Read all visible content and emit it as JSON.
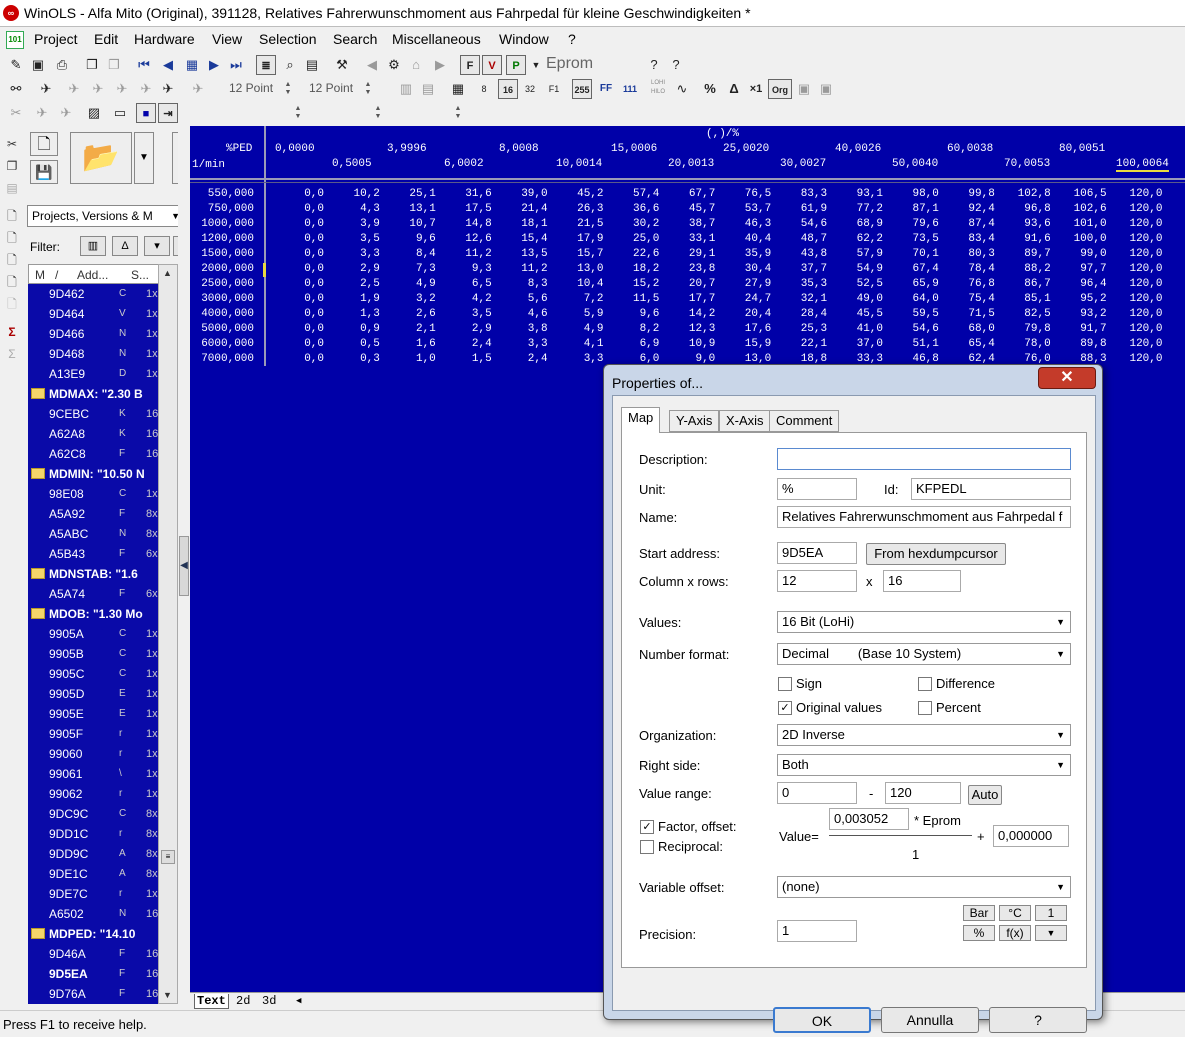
{
  "window": {
    "title": "WinOLS - Alfa Mito (Original), 391128, Relatives Fahrerwunschmoment aus Fahrpedal für kleine Geschwindigkeiten *",
    "app_icon": "winols-logo-icon"
  },
  "menu": [
    "Project",
    "Edit",
    "Hardware",
    "View",
    "Selection",
    "Search",
    "Miscellaneous",
    "Window",
    "?"
  ],
  "toolbar": {
    "eprom_label": "Eprom",
    "point_size_1": "12 Point",
    "point_size_2": "12 Point",
    "btn_255": "255",
    "btn_ff": "FF",
    "btn_111": "111",
    "btn_lohi": "LOHI HILO",
    "btn_x1": "×1",
    "btn_org": "Org"
  },
  "sidebar": {
    "combo": "Projects, Versions & M",
    "filter_label": "Filter:",
    "list_headers": [
      "M",
      "/",
      "Add...",
      "S..."
    ],
    "items": [
      {
        "type": "item",
        "addr": "9D462",
        "c2": "C",
        "c3": "1x"
      },
      {
        "type": "item",
        "addr": "9D464",
        "c2": "V",
        "c3": "1x"
      },
      {
        "type": "item",
        "addr": "9D466",
        "c2": "N",
        "c3": "1x"
      },
      {
        "type": "item",
        "addr": "9D468",
        "c2": "N",
        "c3": "1x"
      },
      {
        "type": "item",
        "addr": "A13E9",
        "c2": "D",
        "c3": "1x"
      },
      {
        "type": "group",
        "name": "MDMAX: \"2.30 B"
      },
      {
        "type": "item",
        "addr": "9CEBC",
        "c2": "K",
        "c3": "16"
      },
      {
        "type": "item",
        "addr": "A62A8",
        "c2": "K",
        "c3": "16"
      },
      {
        "type": "item",
        "addr": "A62C8",
        "c2": "F",
        "c3": "16"
      },
      {
        "type": "group",
        "name": "MDMIN: \"10.50 N"
      },
      {
        "type": "item",
        "addr": "98E08",
        "c2": "C",
        "c3": "1x"
      },
      {
        "type": "item",
        "addr": "A5A92",
        "c2": "F",
        "c3": "8x"
      },
      {
        "type": "item",
        "addr": "A5ABC",
        "c2": "N",
        "c3": "8x"
      },
      {
        "type": "item",
        "addr": "A5B43",
        "c2": "F",
        "c3": "6x"
      },
      {
        "type": "group",
        "name": "MDNSTAB: \"1.6"
      },
      {
        "type": "item",
        "addr": "A5A74",
        "c2": "F",
        "c3": "6x"
      },
      {
        "type": "group",
        "name": "MDOB: \"1.30 Mo"
      },
      {
        "type": "item",
        "addr": "9905A",
        "c2": "C",
        "c3": "1x"
      },
      {
        "type": "item",
        "addr": "9905B",
        "c2": "C",
        "c3": "1x"
      },
      {
        "type": "item",
        "addr": "9905C",
        "c2": "C",
        "c3": "1x"
      },
      {
        "type": "item",
        "addr": "9905D",
        "c2": "E",
        "c3": "1x"
      },
      {
        "type": "item",
        "addr": "9905E",
        "c2": "E",
        "c3": "1x"
      },
      {
        "type": "item",
        "addr": "9905F",
        "c2": "r",
        "c3": "1x"
      },
      {
        "type": "item",
        "addr": "99060",
        "c2": "r",
        "c3": "1x"
      },
      {
        "type": "item",
        "addr": "99061",
        "c2": "\\",
        "c3": "1x"
      },
      {
        "type": "item",
        "addr": "99062",
        "c2": "r",
        "c3": "1x"
      },
      {
        "type": "item",
        "addr": "9DC9C",
        "c2": "C",
        "c3": "8x"
      },
      {
        "type": "item",
        "addr": "9DD1C",
        "c2": "r",
        "c3": "8x"
      },
      {
        "type": "item",
        "addr": "9DD9C",
        "c2": "A",
        "c3": "8x"
      },
      {
        "type": "item",
        "addr": "9DE1C",
        "c2": "A",
        "c3": "8x"
      },
      {
        "type": "item",
        "addr": "9DE7C",
        "c2": "r",
        "c3": "1x"
      },
      {
        "type": "item",
        "addr": "A6502",
        "c2": "N",
        "c3": "16"
      },
      {
        "type": "group",
        "name": "MDPED: \"14.10"
      },
      {
        "type": "item",
        "addr": "9D46A",
        "c2": "F",
        "c3": "16"
      },
      {
        "type": "item",
        "addr": "9D5EA",
        "c2": "F",
        "c3": "16",
        "bold": true
      },
      {
        "type": "item",
        "addr": "9D76A",
        "c2": "F",
        "c3": "16"
      }
    ]
  },
  "map": {
    "unit_top": "(,)/%",
    "x_axis_label": "%PED",
    "y_axis_label": "1/min",
    "x_top": [
      "0,0000",
      "3,9996",
      "8,0008",
      "15,0006",
      "25,0020",
      "40,0026",
      "60,0038",
      "80,0051"
    ],
    "x_bottom": [
      "0,5005",
      "6,0002",
      "10,0014",
      "20,0013",
      "30,0027",
      "50,0040",
      "70,0053",
      "100,0064"
    ],
    "rows": [
      {
        "rpm": "550,000",
        "v": [
          "0,0",
          "10,2",
          "25,1",
          "31,6",
          "39,0",
          "45,2",
          "57,4",
          "67,7",
          "76,5",
          "83,3",
          "93,1",
          "98,0",
          "99,8",
          "102,8",
          "106,5",
          "120,0"
        ]
      },
      {
        "rpm": "750,000",
        "v": [
          "0,0",
          "4,3",
          "13,1",
          "17,5",
          "21,4",
          "26,3",
          "36,6",
          "45,7",
          "53,7",
          "61,9",
          "77,2",
          "87,1",
          "92,4",
          "96,8",
          "102,6",
          "120,0"
        ]
      },
      {
        "rpm": "1000,000",
        "v": [
          "0,0",
          "3,9",
          "10,7",
          "14,8",
          "18,1",
          "21,5",
          "30,2",
          "38,7",
          "46,3",
          "54,6",
          "68,9",
          "79,6",
          "87,4",
          "93,6",
          "101,0",
          "120,0"
        ]
      },
      {
        "rpm": "1200,000",
        "v": [
          "0,0",
          "3,5",
          "9,6",
          "12,6",
          "15,4",
          "17,9",
          "25,0",
          "33,1",
          "40,4",
          "48,7",
          "62,2",
          "73,5",
          "83,4",
          "91,6",
          "100,0",
          "120,0"
        ]
      },
      {
        "rpm": "1500,000",
        "v": [
          "0,0",
          "3,3",
          "8,4",
          "11,2",
          "13,5",
          "15,7",
          "22,6",
          "29,1",
          "35,9",
          "43,8",
          "57,9",
          "70,1",
          "80,3",
          "89,7",
          "99,0",
          "120,0"
        ]
      },
      {
        "rpm": "2000,000",
        "v": [
          "0,0",
          "2,9",
          "7,3",
          "9,3",
          "11,2",
          "13,0",
          "18,2",
          "23,8",
          "30,4",
          "37,7",
          "54,9",
          "67,4",
          "78,4",
          "88,2",
          "97,7",
          "120,0"
        ]
      },
      {
        "rpm": "2500,000",
        "v": [
          "0,0",
          "2,5",
          "4,9",
          "6,5",
          "8,3",
          "10,4",
          "15,2",
          "20,7",
          "27,9",
          "35,3",
          "52,5",
          "65,9",
          "76,8",
          "86,7",
          "96,4",
          "120,0"
        ]
      },
      {
        "rpm": "3000,000",
        "v": [
          "0,0",
          "1,9",
          "3,2",
          "4,2",
          "5,6",
          "7,2",
          "11,5",
          "17,7",
          "24,7",
          "32,1",
          "49,0",
          "64,0",
          "75,4",
          "85,1",
          "95,2",
          "120,0"
        ]
      },
      {
        "rpm": "4000,000",
        "v": [
          "0,0",
          "1,3",
          "2,6",
          "3,5",
          "4,6",
          "5,9",
          "9,6",
          "14,2",
          "20,4",
          "28,4",
          "45,5",
          "59,5",
          "71,5",
          "82,5",
          "93,2",
          "120,0"
        ]
      },
      {
        "rpm": "5000,000",
        "v": [
          "0,0",
          "0,9",
          "2,1",
          "2,9",
          "3,8",
          "4,9",
          "8,2",
          "12,3",
          "17,6",
          "25,3",
          "41,0",
          "54,6",
          "68,0",
          "79,8",
          "91,7",
          "120,0"
        ]
      },
      {
        "rpm": "6000,000",
        "v": [
          "0,0",
          "0,5",
          "1,6",
          "2,4",
          "3,3",
          "4,1",
          "6,9",
          "10,9",
          "15,9",
          "22,1",
          "37,0",
          "51,1",
          "65,4",
          "78,0",
          "89,8",
          "120,0"
        ]
      },
      {
        "rpm": "7000,000",
        "v": [
          "0,0",
          "0,3",
          "1,0",
          "1,5",
          "2,4",
          "3,3",
          "6,0",
          "9,0",
          "13,0",
          "18,8",
          "33,3",
          "46,8",
          "62,4",
          "76,0",
          "88,3",
          "120,0"
        ]
      }
    ],
    "tabs": [
      "Text",
      "2d",
      "3d"
    ]
  },
  "dialog": {
    "title": "Properties of...",
    "tabs": [
      "Map",
      "Y-Axis",
      "X-Axis",
      "Comment"
    ],
    "description_label": "Description:",
    "description_value": "",
    "unit_label": "Unit:",
    "unit_value": "%",
    "id_label": "Id:",
    "id_value": "KFPEDL",
    "name_label": "Name:",
    "name_value": "Relatives Fahrerwunschmoment aus Fahrpedal f",
    "start_address_label": "Start address:",
    "start_address_value": "9D5EA",
    "from_hexdump_button": "From hexdumpcursor",
    "colrows_label": "Column x rows:",
    "columns_value": "12",
    "x_sep": "x",
    "rows_value": "16",
    "values_label": "Values:",
    "values_selected": "16 Bit (LoHi)",
    "number_format_label": "Number format:",
    "number_format_selected": "Decimal        (Base 10 System)",
    "sign_label": "Sign",
    "difference_label": "Difference",
    "original_values_label": "Original values",
    "percent_label": "Percent",
    "sign_checked": false,
    "difference_checked": false,
    "original_values_checked": true,
    "percent_checked": false,
    "organization_label": "Organization:",
    "organization_selected": "2D Inverse",
    "right_side_label": "Right side:",
    "right_side_selected": "Both",
    "value_range_label": "Value range:",
    "range_min": "0",
    "range_dash": "-",
    "range_max": "120",
    "auto_button": "Auto",
    "factor_offset_label": "Factor, offset:",
    "factor_offset_checked": true,
    "reciprocal_label": "Reciprocal:",
    "reciprocal_checked": false,
    "value_eq": "Value=",
    "factor_value": "0,003052",
    "eprom_mult": "* Eprom",
    "denominator": "1",
    "plus": "+",
    "offset_value": "0,000000",
    "variable_offset_label": "Variable offset:",
    "variable_offset_selected": "(none)",
    "precision_label": "Precision:",
    "precision_value": "1",
    "unit_buttons": [
      "Bar",
      "°C",
      "1",
      "%",
      "f(x)",
      "▼"
    ],
    "ok_button": "OK",
    "cancel_button": "Annulla",
    "help_button": "?"
  },
  "status": "Press F1 to receive help."
}
